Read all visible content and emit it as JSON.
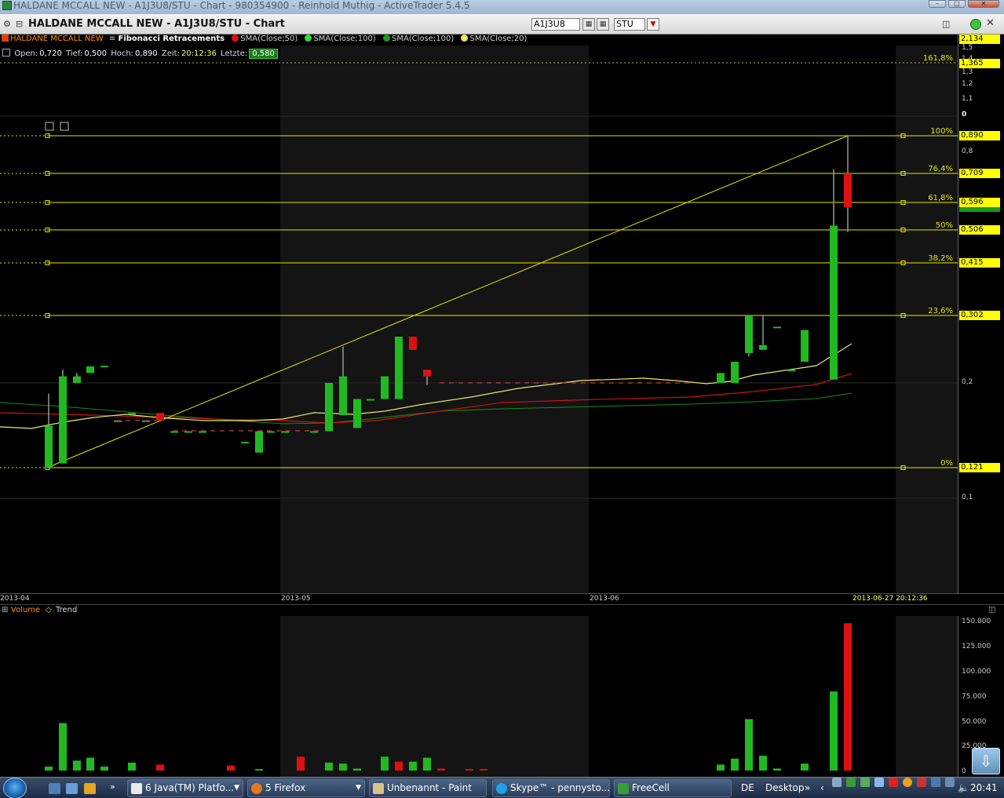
{
  "window": {
    "os_title": "HALDANE MCCALL NEW - A1J3U8/STU - Chart - 980354900 - Reinhold Muthig - ActiveTrader 5.4.5",
    "chart_title": "HALDANE MCCALL NEW - A1J3U8/STU - Chart",
    "symbol_input": "A1J3U8",
    "exchange_input": "STU"
  },
  "legend": {
    "instrument": "HALDANE MCCALL NEW",
    "fib": "Fibonacci Retracements",
    "sma50": "SMA(Close;50)",
    "sma100a": "SMA(Close;100)",
    "sma100b": "SMA(Close;100)",
    "sma20": "SMA(Close;20)"
  },
  "info": {
    "open_label": "Open:",
    "open": "0,720",
    "tief_label": "Tief:",
    "tief": "0,500",
    "hoch_label": "Hoch:",
    "hoch": "0,890",
    "zeit_label": "Zeit:",
    "zeit": "20:12:36",
    "letzte_label": "Letzte:",
    "letzte": "0,580"
  },
  "price_axis": {
    "top_box": "2,134",
    "ticks": [
      "1,5",
      "1,4",
      "1,3",
      "1,2",
      "1,1",
      "0",
      "0,8",
      "0,2",
      "0,1"
    ],
    "boxes": [
      "1,365",
      "0,890",
      "0,709",
      "0,596",
      "0,506",
      "0,415",
      "0,302",
      "0,121"
    ]
  },
  "dates": {
    "d1": "2013-04",
    "d2": "2013-05",
    "d3": "2013-06",
    "current": "2013-06-27 20:12:36"
  },
  "volume_legend": {
    "volume": "Volume",
    "trend": "Trend"
  },
  "volume_axis": [
    "150.000",
    "125.000",
    "100.000",
    "75.000",
    "50.000",
    "25.000",
    "0"
  ],
  "taskbar": {
    "java": "6 Java(TM) Platfo...",
    "firefox": "5 Firefox",
    "paint": "Unbenannt - Paint",
    "skype": "Skype™ - pennysto...",
    "freecell": "FreeCell",
    "lang": "DE",
    "desktop": "Desktop",
    "clock": "20:41"
  },
  "colors": {
    "up": "#22b822",
    "down": "#dd1111",
    "fib": "#e6e600",
    "sma20": "#e8e870",
    "sma50": "#cc1111",
    "sma100": "#1a8a1a"
  },
  "chart_data": {
    "type": "candlestick",
    "title": "HALDANE MCCALL NEW - A1J3U8/STU",
    "fibonacci": {
      "levels": [
        {
          "label": "161,8%",
          "price": 1.365
        },
        {
          "label": "100%",
          "price": 0.89
        },
        {
          "label": "76,4%",
          "price": 0.709
        },
        {
          "label": "61,8%",
          "price": 0.596
        },
        {
          "label": "50%",
          "price": 0.506
        },
        {
          "label": "38,2%",
          "price": 0.415
        },
        {
          "label": "23,6%",
          "price": 0.302
        },
        {
          "label": "0%",
          "price": 0.121
        }
      ]
    },
    "candles": [
      {
        "o": 0.121,
        "h": 0.19,
        "l": 0.121,
        "c": 0.16
      },
      {
        "o": 0.125,
        "h": 0.22,
        "l": 0.125,
        "c": 0.21
      },
      {
        "o": 0.2,
        "h": 0.215,
        "l": 0.2,
        "c": 0.21
      },
      {
        "o": 0.215,
        "h": 0.225,
        "l": 0.215,
        "c": 0.225
      },
      {
        "o": 0.226,
        "h": 0.226,
        "l": 0.226,
        "c": 0.226
      },
      {
        "o": 0.165,
        "h": 0.165,
        "l": 0.165,
        "c": 0.165
      },
      {
        "o": 0.172,
        "h": 0.172,
        "l": 0.172,
        "c": 0.172
      },
      {
        "o": 0.165,
        "h": 0.165,
        "l": 0.165,
        "c": 0.165
      },
      {
        "o": 0.172,
        "h": 0.172,
        "l": 0.165,
        "c": 0.165
      },
      {
        "o": 0.155,
        "h": 0.155,
        "l": 0.155,
        "c": 0.155
      },
      {
        "o": 0.155,
        "h": 0.155,
        "l": 0.155,
        "c": 0.155
      },
      {
        "o": 0.155,
        "h": 0.155,
        "l": 0.155,
        "c": 0.155
      },
      {
        "o": 0.145,
        "h": 0.145,
        "l": 0.145,
        "c": 0.145
      },
      {
        "o": 0.135,
        "h": 0.155,
        "l": 0.135,
        "c": 0.155
      },
      {
        "o": 0.155,
        "h": 0.155,
        "l": 0.155,
        "c": 0.155
      },
      {
        "o": 0.155,
        "h": 0.155,
        "l": 0.155,
        "c": 0.155
      },
      {
        "o": 0.155,
        "h": 0.155,
        "l": 0.155,
        "c": 0.155
      },
      {
        "o": 0.155,
        "h": 0.2,
        "l": 0.155,
        "c": 0.2
      },
      {
        "o": 0.17,
        "h": 0.255,
        "l": 0.17,
        "c": 0.21
      },
      {
        "o": 0.158,
        "h": 0.185,
        "l": 0.158,
        "c": 0.185
      },
      {
        "o": 0.185,
        "h": 0.185,
        "l": 0.185,
        "c": 0.185
      },
      {
        "o": 0.185,
        "h": 0.21,
        "l": 0.185,
        "c": 0.21
      },
      {
        "o": 0.185,
        "h": 0.27,
        "l": 0.185,
        "c": 0.27
      },
      {
        "o": 0.27,
        "h": 0.27,
        "l": 0.25,
        "c": 0.25
      },
      {
        "o": 0.22,
        "h": 0.22,
        "l": 0.198,
        "c": 0.21
      }
    ]
  }
}
